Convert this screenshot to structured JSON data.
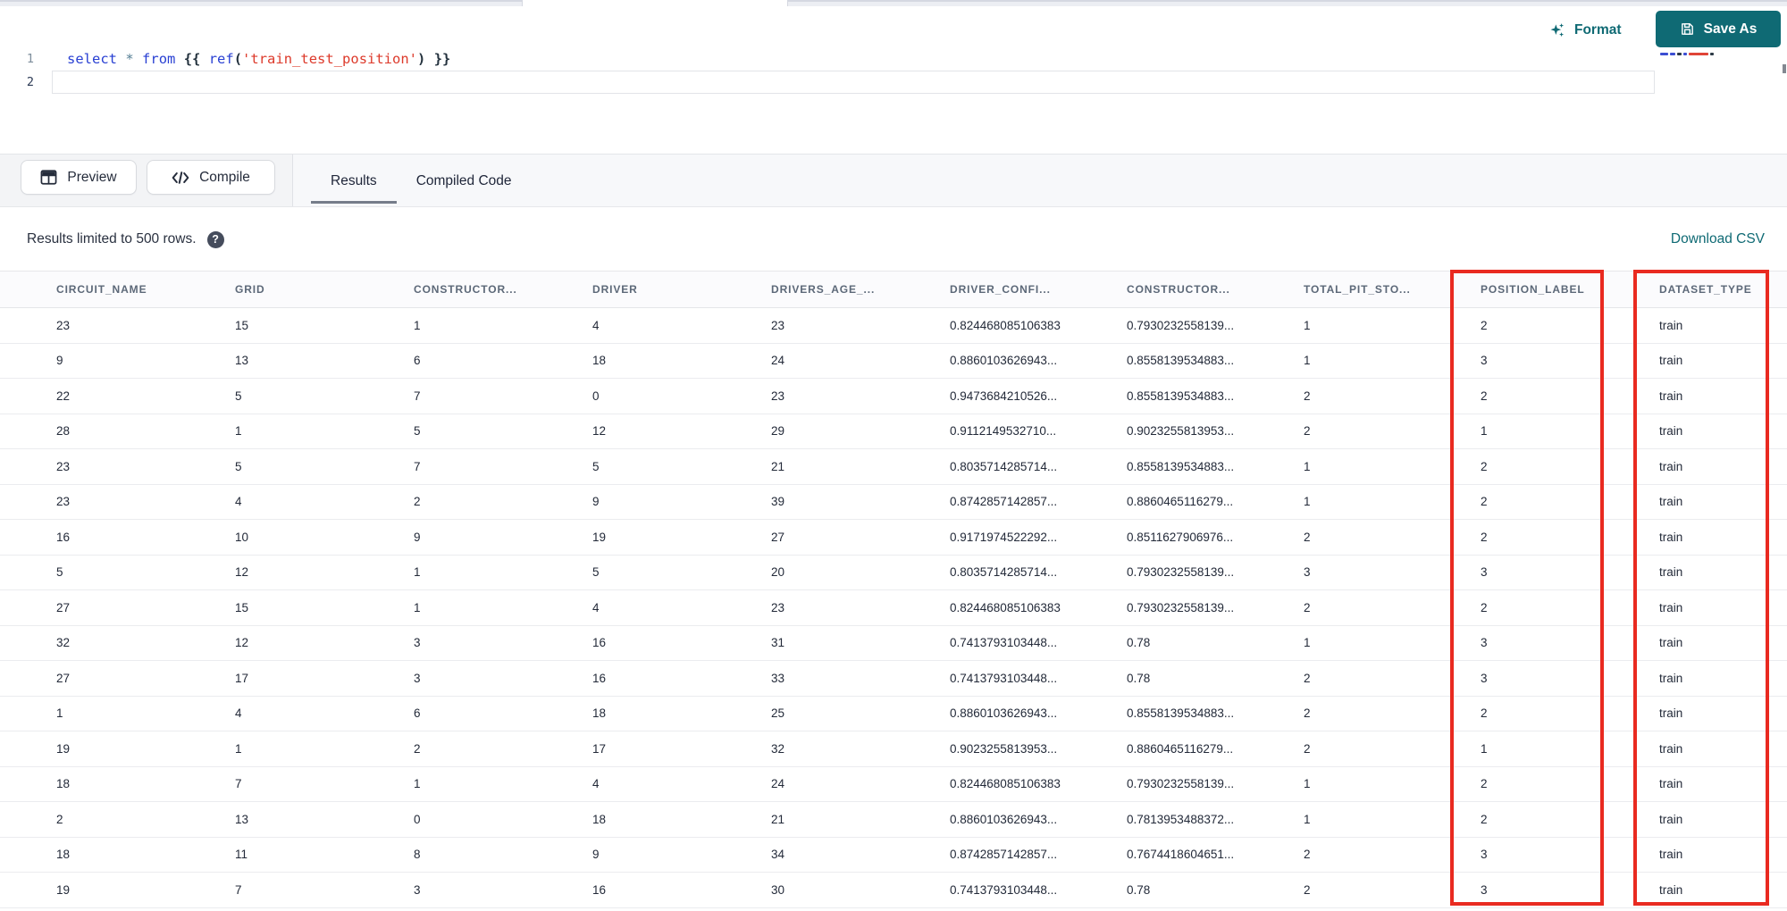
{
  "editor": {
    "format_button": "Format",
    "save_as_button": "Save As",
    "lines": [
      {
        "number": "1",
        "active": false,
        "tokens": [
          {
            "type": "keyword",
            "text": "select"
          },
          {
            "type": "plain",
            "text": " "
          },
          {
            "type": "operator",
            "text": "*"
          },
          {
            "type": "plain",
            "text": " "
          },
          {
            "type": "keyword",
            "text": "from"
          },
          {
            "type": "plain",
            "text": " "
          },
          {
            "type": "bracket",
            "text": "{{ "
          },
          {
            "type": "keyword",
            "text": "ref"
          },
          {
            "type": "bracket",
            "text": "("
          },
          {
            "type": "string",
            "text": "'train_test_position'"
          },
          {
            "type": "bracket",
            "text": ")"
          },
          {
            "type": "bracket",
            "text": " }}"
          }
        ]
      },
      {
        "number": "2",
        "active": true,
        "tokens": []
      }
    ]
  },
  "toolbar": {
    "preview_button": "Preview",
    "compile_button": "Compile",
    "tabs": [
      {
        "label": "Results",
        "active": true
      },
      {
        "label": "Compiled Code",
        "active": false
      }
    ]
  },
  "results_bar": {
    "info_text": "Results limited to 500 rows.",
    "help_glyph": "?",
    "download_link": "Download CSV"
  },
  "table": {
    "columns": [
      "CIRCUIT_NAME",
      "GRID",
      "CONSTRUCTOR...",
      "DRIVER",
      "DRIVERS_AGE_...",
      "DRIVER_CONFI...",
      "CONSTRUCTOR...",
      "TOTAL_PIT_STO...",
      "POSITION_LABEL",
      "DATASET_TYPE"
    ],
    "rows": [
      [
        "23",
        "15",
        "1",
        "4",
        "23",
        "0.824468085106383",
        "0.7930232558139...",
        "1",
        "2",
        "train"
      ],
      [
        "9",
        "13",
        "6",
        "18",
        "24",
        "0.8860103626943...",
        "0.8558139534883...",
        "1",
        "3",
        "train"
      ],
      [
        "22",
        "5",
        "7",
        "0",
        "23",
        "0.9473684210526...",
        "0.8558139534883...",
        "2",
        "2",
        "train"
      ],
      [
        "28",
        "1",
        "5",
        "12",
        "29",
        "0.9112149532710...",
        "0.9023255813953...",
        "2",
        "1",
        "train"
      ],
      [
        "23",
        "5",
        "7",
        "5",
        "21",
        "0.8035714285714...",
        "0.8558139534883...",
        "1",
        "2",
        "train"
      ],
      [
        "23",
        "4",
        "2",
        "9",
        "39",
        "0.8742857142857...",
        "0.8860465116279...",
        "1",
        "2",
        "train"
      ],
      [
        "16",
        "10",
        "9",
        "19",
        "27",
        "0.9171974522292...",
        "0.8511627906976...",
        "2",
        "2",
        "train"
      ],
      [
        "5",
        "12",
        "1",
        "5",
        "20",
        "0.8035714285714...",
        "0.7930232558139...",
        "3",
        "3",
        "train"
      ],
      [
        "27",
        "15",
        "1",
        "4",
        "23",
        "0.824468085106383",
        "0.7930232558139...",
        "2",
        "2",
        "train"
      ],
      [
        "32",
        "12",
        "3",
        "16",
        "31",
        "0.7413793103448...",
        "0.78",
        "1",
        "3",
        "train"
      ],
      [
        "27",
        "17",
        "3",
        "16",
        "33",
        "0.7413793103448...",
        "0.78",
        "2",
        "3",
        "train"
      ],
      [
        "1",
        "4",
        "6",
        "18",
        "25",
        "0.8860103626943...",
        "0.8558139534883...",
        "2",
        "2",
        "train"
      ],
      [
        "19",
        "1",
        "2",
        "17",
        "32",
        "0.9023255813953...",
        "0.8860465116279...",
        "2",
        "1",
        "train"
      ],
      [
        "18",
        "7",
        "1",
        "4",
        "24",
        "0.824468085106383",
        "0.7930232558139...",
        "1",
        "2",
        "train"
      ],
      [
        "2",
        "13",
        "0",
        "18",
        "21",
        "0.8860103626943...",
        "0.7813953488372...",
        "1",
        "2",
        "train"
      ],
      [
        "18",
        "11",
        "8",
        "9",
        "34",
        "0.8742857142857...",
        "0.7674418604651...",
        "2",
        "3",
        "train"
      ],
      [
        "19",
        "7",
        "3",
        "16",
        "30",
        "0.7413793103448...",
        "0.78",
        "2",
        "3",
        "train"
      ]
    ]
  },
  "annotations": {
    "color": "#e92a20",
    "boxes": [
      {
        "target_column": "POSITION_LABEL"
      },
      {
        "target_column": "DATASET_TYPE"
      }
    ]
  },
  "colors": {
    "accent_teal": "#0f6a74",
    "keyword_blue": "#2940d3",
    "string_red": "#dd3a2b"
  }
}
